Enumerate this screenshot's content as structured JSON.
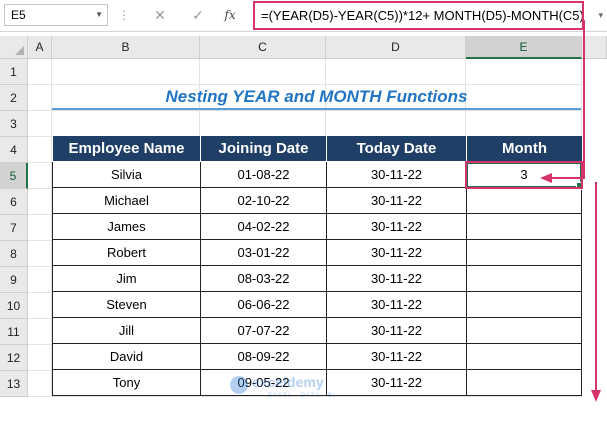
{
  "formula_bar": {
    "name_box": "E5",
    "cancel_symbol": "✕",
    "enter_symbol": "✓",
    "fx_label": "fx",
    "formula": "=(YEAR(D5)-YEAR(C5))*12+ MONTH(D5)-MONTH(C5)"
  },
  "columns": [
    "A",
    "B",
    "C",
    "D",
    "E"
  ],
  "selected_column": "E",
  "rows": [
    "1",
    "2",
    "3",
    "4",
    "5",
    "6",
    "7",
    "8",
    "9",
    "10",
    "11",
    "12",
    "13"
  ],
  "selected_row": "5",
  "title": "Nesting YEAR and MONTH Functions",
  "table": {
    "headers": [
      "Employee Name",
      "Joining Date",
      "Today Date",
      "Month"
    ],
    "rows": [
      [
        "Silvia",
        "01-08-22",
        "30-11-22",
        "3"
      ],
      [
        "Michael",
        "02-10-22",
        "30-11-22",
        ""
      ],
      [
        "James",
        "04-02-22",
        "30-11-22",
        ""
      ],
      [
        "Robert",
        "03-01-22",
        "30-11-22",
        ""
      ],
      [
        "Jim",
        "08-03-22",
        "30-11-22",
        ""
      ],
      [
        "Steven",
        "06-06-22",
        "30-11-22",
        ""
      ],
      [
        "Jill",
        "07-07-22",
        "30-11-22",
        ""
      ],
      [
        "David",
        "08-09-22",
        "30-11-22",
        ""
      ],
      [
        "Tony",
        "09-05-22",
        "30-11-22",
        ""
      ]
    ]
  },
  "watermark": {
    "name": "exceldemy",
    "tagline": "EXCEL · DATA · BI"
  },
  "colors": {
    "header_fill": "#1f3f66",
    "title_color": "#1f75c4",
    "annotation": "#d6336c",
    "selection": "#217346"
  }
}
